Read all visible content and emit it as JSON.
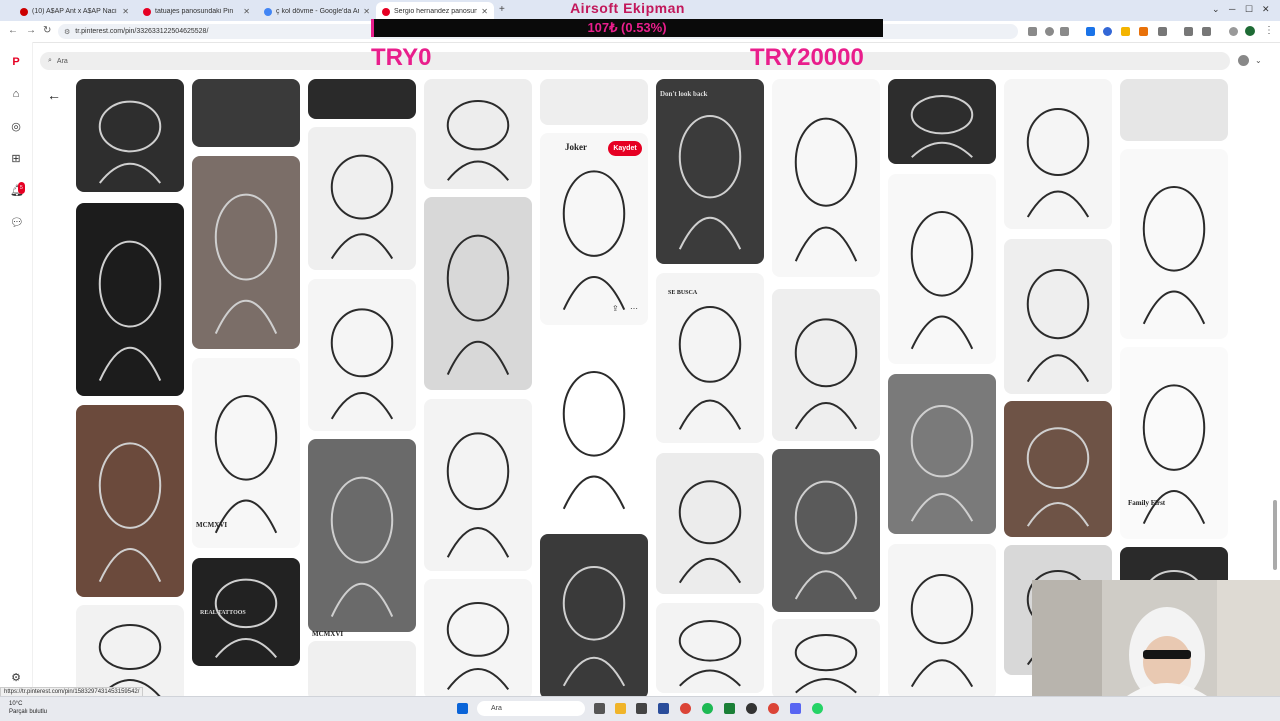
{
  "tabs": [
    {
      "title": "(10) A$AP Ant x A$AP Naci",
      "color": "#cc0000"
    },
    {
      "title": "tatuajes panosundaki Pin",
      "color": "#e60023"
    },
    {
      "title": "ç kol dövme - Google'da Ara",
      "color": "#4285f4"
    },
    {
      "title": "Sergio hernandez panosundaki",
      "color": "#e60023",
      "active": true
    }
  ],
  "address": {
    "url": "tr.pinterest.com/pin/332633122504625528/"
  },
  "overlay": {
    "title": "Airsoft Ekipman",
    "amount": "107₺ (0.53%)",
    "min_label": "TRY0",
    "max_label": "TRY20000",
    "progress_fraction": 0.0053
  },
  "pinterest": {
    "search_placeholder": "Ara",
    "save_button": "Kaydet",
    "notification_count": "5",
    "pin_titles": [
      "MCMXVI",
      "MCMXVI",
      "Don't look back",
      "SE BUSCA",
      "Family First",
      "REAL TATTOOS",
      "Joker"
    ]
  },
  "status": {
    "hover_url": "https://tr.pinterest.com/pin/1583297431453159542/"
  },
  "taskbar": {
    "temperature": "10°C",
    "weather": "Parçalı bulutlu",
    "search_placeholder": "Ara"
  },
  "colors": {
    "brand": "#e60023",
    "overlay_accent": "#e91e8c"
  }
}
